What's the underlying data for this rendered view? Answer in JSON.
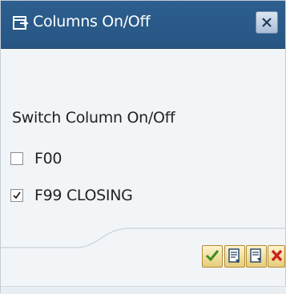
{
  "dialog": {
    "title": "Columns On/Off",
    "title_icon": "window-icon",
    "close_icon": "close-icon"
  },
  "section": {
    "label": "Switch Column On/Off"
  },
  "columns": [
    {
      "label": "F00",
      "checked": false
    },
    {
      "label": "F99 CLOSING",
      "checked": true
    }
  ],
  "toolbar": {
    "buttons": [
      {
        "icon": "checkmark-icon",
        "color": "#3a8f1e"
      },
      {
        "icon": "select-all-icon",
        "color": "#2e4a6a"
      },
      {
        "icon": "deselect-all-icon",
        "color": "#2e4a6a"
      },
      {
        "icon": "cancel-icon",
        "color": "#cc1f1f"
      }
    ]
  },
  "colors": {
    "titlebar": "#2c5e8f",
    "background": "#f2f5f8"
  }
}
